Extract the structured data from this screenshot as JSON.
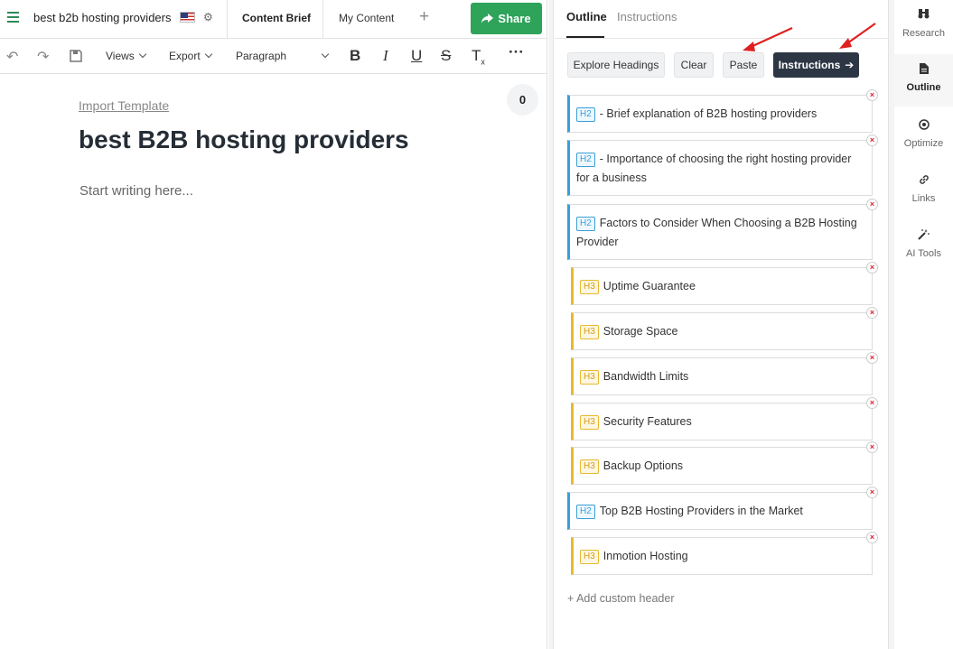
{
  "editor": {
    "doc_title": "best b2b hosting providers",
    "tabs": [
      {
        "label": "Content Brief"
      },
      {
        "label": "My Content"
      }
    ],
    "share_label": "Share",
    "toolbar": {
      "views_label": "Views",
      "export_label": "Export",
      "paragraph_label": "Paragraph"
    },
    "import_template": "Import Template",
    "word_count": "0",
    "heading": "best B2B hosting providers",
    "placeholder": "Start writing here..."
  },
  "outline_panel": {
    "tabs": [
      {
        "label": "Outline"
      },
      {
        "label": "Instructions"
      }
    ],
    "buttons": {
      "explore": "Explore Headings",
      "clear": "Clear",
      "paste": "Paste",
      "instructions": "Instructions"
    },
    "headings": [
      {
        "level": "H2",
        "text": "- Brief explanation of B2B hosting providers"
      },
      {
        "level": "H2",
        "text": "- Importance of choosing the right hosting provider for a business"
      },
      {
        "level": "H2",
        "text": "Factors to Consider When Choosing a B2B Hosting Provider"
      },
      {
        "level": "H3",
        "text": "Uptime Guarantee"
      },
      {
        "level": "H3",
        "text": "Storage Space"
      },
      {
        "level": "H3",
        "text": "Bandwidth Limits"
      },
      {
        "level": "H3",
        "text": "Security Features"
      },
      {
        "level": "H3",
        "text": "Backup Options"
      },
      {
        "level": "H2",
        "text": "Top B2B Hosting Providers in the Market"
      },
      {
        "level": "H3",
        "text": "Inmotion Hosting"
      }
    ],
    "add_custom_header": "+ Add custom header"
  },
  "rail": {
    "items": [
      {
        "label": "Research",
        "icon": "binoculars-icon"
      },
      {
        "label": "Outline",
        "icon": "document-icon"
      },
      {
        "label": "Optimize",
        "icon": "target-icon"
      },
      {
        "label": "Links",
        "icon": "link-icon"
      },
      {
        "label": "AI Tools",
        "icon": "magic-wand-icon"
      }
    ]
  },
  "colors": {
    "share_green": "#2ea35a",
    "h2_accent": "#3a9fd9",
    "h3_accent": "#e8b92d",
    "dark_button": "#2d3644",
    "annotation_red": "#e02020"
  }
}
